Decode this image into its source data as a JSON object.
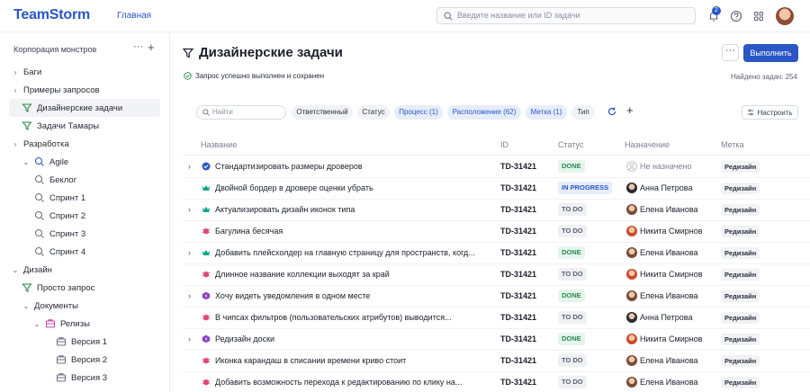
{
  "header": {
    "logo": "TeamStorm",
    "nav_home": "Главная",
    "search_placeholder": "Введите название или ID задачи",
    "notifications_count": "2",
    "icons": [
      "bell-icon",
      "help-icon",
      "apps-grid-icon",
      "user-avatar"
    ]
  },
  "sidebar": {
    "title": "Корпорация монстров",
    "items": [
      {
        "label": "Баги",
        "icon": "chevron-right"
      },
      {
        "label": "Примеры запросов",
        "icon": "chevron-right"
      },
      {
        "label": "Дизайнерские задачи",
        "icon": "filter-icon",
        "active": true
      },
      {
        "label": "Задачи Тамары",
        "icon": "filter-icon"
      },
      {
        "label": "Разработка",
        "icon": "chevron-right"
      },
      {
        "label": "Agile",
        "icon": "agile-icon"
      },
      {
        "label": "Беклог",
        "icon": "sprint-icon"
      },
      {
        "label": "Спринт 1",
        "icon": "sprint-icon"
      },
      {
        "label": "Спринт 2",
        "icon": "sprint-icon"
      },
      {
        "label": "Спринт 3",
        "icon": "sprint-icon"
      },
      {
        "label": "Спринт 4",
        "icon": "sprint-icon"
      },
      {
        "label": "Дизайн",
        "icon": "chevron-down"
      },
      {
        "label": "Просто запрос",
        "icon": "filter-icon"
      },
      {
        "label": "Документы",
        "icon": "chevron-down"
      },
      {
        "label": "Релизы",
        "icon": "release-icon"
      },
      {
        "label": "Версия 1",
        "icon": "version-icon"
      },
      {
        "label": "Версия 2",
        "icon": "version-icon"
      },
      {
        "label": "Версия 3",
        "icon": "version-icon"
      }
    ]
  },
  "main": {
    "title": "Дизайнерские задачи",
    "run_button": "Выполнить",
    "more_button": "···",
    "success_message": "Запрос успешно выполнен и сохранен",
    "found_count": "Найдено задач: 254",
    "filters": {
      "search_placeholder": "Найти",
      "chips": [
        "Ответственный",
        "Статус",
        "Процесс (1)",
        "Расположение (62)",
        "Метка (1)",
        "Тип"
      ],
      "configure": "Настроить"
    },
    "columns": [
      "Название",
      "ID",
      "Статус",
      "Назначение",
      "Метка"
    ],
    "rows": [
      {
        "title": "Стандартизировать размеры дроверов",
        "id": "TD-31421",
        "status": "DONE",
        "assignee": "Не назначено",
        "label": "Редизайн"
      },
      {
        "title": "Двойной бордер в дровере оценки убрать",
        "id": "TD-31421",
        "status": "IN PROGRESS",
        "assignee": "Анна Петрова",
        "label": "Редизайн"
      },
      {
        "title": "Актуализировать дизайн иконок типа",
        "id": "TD-31421",
        "status": "TO DO",
        "assignee": "Елена Иванова",
        "label": "Редизайн"
      },
      {
        "title": "Багулина бесячая",
        "id": "TD-31421",
        "status": "TO DO",
        "assignee": "Никита Смирнов",
        "label": "Редизайн"
      },
      {
        "title": "Добавить плейсхолдер на главную страницу для пространств, когд...",
        "id": "TD-31421",
        "status": "DONE",
        "assignee": "Елена Иванова",
        "label": "Редизайн"
      },
      {
        "title": "Длинное название коллекции выходят за край",
        "id": "TD-31421",
        "status": "TO DO",
        "assignee": "Никита Смирнов",
        "label": "Редизайн"
      },
      {
        "title": "Хочу видеть уведомления в одном месте",
        "id": "TD-31421",
        "status": "DONE",
        "assignee": "Елена Иванова",
        "label": "Редизайн"
      },
      {
        "title": "В чипсах фильтров (пользовательских атрибутов)  выводится...",
        "id": "TD-31421",
        "status": "TO DO",
        "assignee": "Анна Петрова",
        "label": "Редизайн"
      },
      {
        "title": "Редизайн доски",
        "id": "TD-31421",
        "status": "DONE",
        "assignee": "Никита Смирнов",
        "label": "Редизайн"
      },
      {
        "title": "Иконка карандаш в списании времени криво стоит",
        "id": "TD-31421",
        "status": "TO DO",
        "assignee": "Елена Иванова",
        "label": "Редизайн"
      },
      {
        "title": "Добавить возможность перехода к редактированию по клику на...",
        "id": "TD-31421",
        "status": "TO DO",
        "assignee": "Елена Иванова",
        "label": "Редизайн"
      }
    ]
  },
  "colors": {
    "brand": "#2a56c6",
    "done": "#2b8a4e",
    "todo": "#5b6170"
  }
}
